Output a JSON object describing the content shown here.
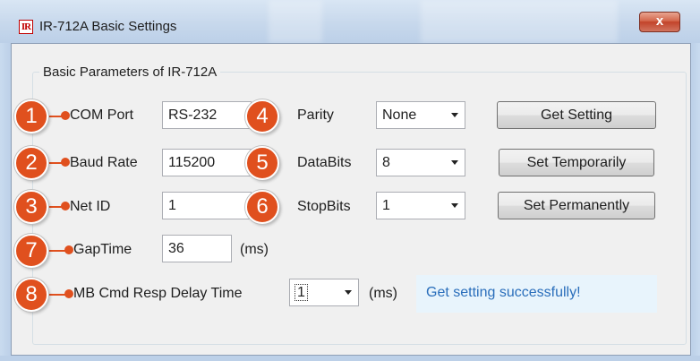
{
  "window": {
    "title": "IR-712A Basic Settings",
    "app_icon_text": "IR",
    "close_glyph": "x"
  },
  "group": {
    "title": "Basic Parameters of IR-712A"
  },
  "fields": {
    "com_port": {
      "label": "COM Port",
      "value": "RS-232"
    },
    "baud_rate": {
      "label": "Baud Rate",
      "value": "115200"
    },
    "net_id": {
      "label": "Net ID",
      "value": "1"
    },
    "parity": {
      "label": "Parity",
      "value": "None"
    },
    "data_bits": {
      "label": "DataBits",
      "value": "8"
    },
    "stop_bits": {
      "label": "StopBits",
      "value": "1"
    },
    "gap_time": {
      "label": "GapTime",
      "value": "36",
      "unit": "(ms)"
    },
    "mb_delay": {
      "label": "MB Cmd Resp Delay Time",
      "value": "1",
      "unit": "(ms)"
    }
  },
  "buttons": {
    "get_setting": "Get Setting",
    "set_temporarily": "Set Temporarily",
    "set_permanently": "Set Permanently"
  },
  "status": {
    "message": "Get setting successfully!"
  },
  "callouts": [
    "1",
    "2",
    "3",
    "4",
    "5",
    "6",
    "7",
    "8"
  ],
  "colors": {
    "accent": "#e0501e",
    "status_text": "#2a6ebb",
    "status_bg": "#e8f4fc",
    "close_red": "#c2432a"
  }
}
